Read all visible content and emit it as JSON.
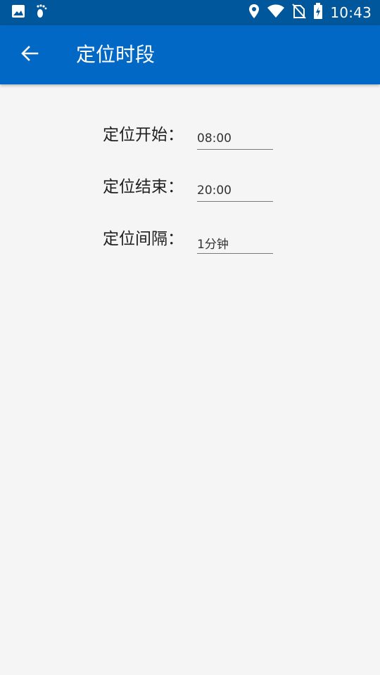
{
  "status_bar": {
    "time": "10:43",
    "left_icons": [
      "image-icon",
      "footprint-icon"
    ],
    "right_icons": [
      "location-icon",
      "wifi-icon",
      "no-sim-icon",
      "battery-charging-icon"
    ]
  },
  "app_bar": {
    "title": "定位时段",
    "back_icon": "arrow-back-icon",
    "color": "#0268c6"
  },
  "form": {
    "start_label": "定位开始：",
    "start_value": "08:00",
    "end_label": "定位结束：",
    "end_value": "20:00",
    "interval_label": "定位间隔：",
    "interval_value": "1分钟"
  }
}
